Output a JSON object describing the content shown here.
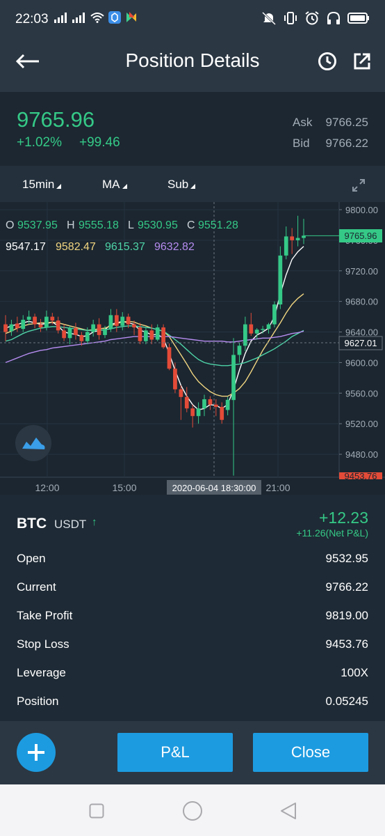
{
  "status_bar": {
    "time": "22:03",
    "icons_left": [
      "signal-icon",
      "signal-icon",
      "wifi-icon",
      "app-icon",
      "app-icon"
    ],
    "icons_right": [
      "mute-icon",
      "vibrate-icon",
      "alarm-icon",
      "headphones-icon",
      "battery-icon"
    ]
  },
  "header": {
    "title": "Position Details",
    "back_icon": "arrow-left-icon",
    "history_icon": "clock-icon",
    "share_icon": "external-link-icon"
  },
  "price": {
    "last": "9765.96",
    "change_pct": "+1.02%",
    "change_abs": "+99.46",
    "ask_label": "Ask",
    "ask": "9766.25",
    "bid_label": "Bid",
    "bid": "9766.22"
  },
  "toolbar": {
    "interval": "15min",
    "indicator": "MA",
    "sub": "Sub",
    "expand_icon": "expand-icon"
  },
  "chart": {
    "ohlc": {
      "o_label": "O",
      "o": "9537.95",
      "h_label": "H",
      "h": "9555.18",
      "l_label": "L",
      "l": "9530.95",
      "c_label": "C",
      "c": "9551.28"
    },
    "ma_values": [
      "9547.17",
      "9582.47",
      "9615.37",
      "9632.82"
    ],
    "ma_colors": [
      "#ffffff",
      "#f2d681",
      "#4fd4a8",
      "#b68cf0"
    ],
    "y_ticks": [
      "9800.00",
      "9760.00",
      "9720.00",
      "9680.00",
      "9640.00",
      "9600.00",
      "9560.00",
      "9520.00",
      "9480.00"
    ],
    "x_ticks": [
      "12:00",
      "15:00",
      "21:00"
    ],
    "crosshair_time": "2020-06-04 18:30:00",
    "crosshair_price": "9627.01",
    "last_price_tag": "9765.96",
    "bottom_tag": "9453.76",
    "up_color": "#35c987",
    "down_color": "#e34b38"
  },
  "chart_data": {
    "type": "candlestick",
    "y_range": [
      9450,
      9810
    ],
    "x_ticks": [
      "12:00",
      "15:00",
      "21:00"
    ],
    "y_ticks": [
      9800,
      9760,
      9720,
      9680,
      9640,
      9600,
      9560,
      9520,
      9480
    ],
    "candles": [
      [
        9650,
        9662,
        9628,
        9640
      ],
      [
        9641,
        9656,
        9635,
        9650
      ],
      [
        9651,
        9660,
        9640,
        9645
      ],
      [
        9644,
        9662,
        9640,
        9656
      ],
      [
        9656,
        9668,
        9650,
        9660
      ],
      [
        9660,
        9664,
        9645,
        9650
      ],
      [
        9650,
        9657,
        9640,
        9646
      ],
      [
        9646,
        9668,
        9642,
        9660
      ],
      [
        9660,
        9665,
        9650,
        9655
      ],
      [
        9655,
        9660,
        9638,
        9642
      ],
      [
        9642,
        9650,
        9628,
        9632
      ],
      [
        9632,
        9648,
        9624,
        9645
      ],
      [
        9645,
        9652,
        9630,
        9636
      ],
      [
        9636,
        9640,
        9622,
        9628
      ],
      [
        9628,
        9646,
        9624,
        9640
      ],
      [
        9640,
        9656,
        9634,
        9650
      ],
      [
        9650,
        9658,
        9630,
        9636
      ],
      [
        9636,
        9648,
        9632,
        9644
      ],
      [
        9644,
        9670,
        9640,
        9662
      ],
      [
        9662,
        9670,
        9640,
        9648
      ],
      [
        9648,
        9666,
        9642,
        9660
      ],
      [
        9660,
        9664,
        9645,
        9650
      ],
      [
        9650,
        9655,
        9636,
        9646
      ],
      [
        9646,
        9652,
        9624,
        9628
      ],
      [
        9628,
        9646,
        9624,
        9642
      ],
      [
        9642,
        9650,
        9624,
        9630
      ],
      [
        9630,
        9650,
        9628,
        9646
      ],
      [
        9646,
        9650,
        9618,
        9620
      ],
      [
        9620,
        9625,
        9590,
        9592
      ],
      [
        9592,
        9600,
        9560,
        9565
      ],
      [
        9565,
        9570,
        9525,
        9555
      ],
      [
        9555,
        9568,
        9535,
        9540
      ],
      [
        9540,
        9545,
        9515,
        9530
      ],
      [
        9530,
        9548,
        9520,
        9540
      ],
      [
        9540,
        9558,
        9530,
        9552
      ],
      [
        9552,
        9556,
        9538,
        9545
      ],
      [
        9545,
        9552,
        9530,
        9542
      ],
      [
        9542,
        9548,
        9520,
        9525
      ],
      [
        9537.95,
        9555.18,
        9530.95,
        9551.28
      ],
      [
        9551,
        9632,
        9452,
        9610
      ],
      [
        9610,
        9626,
        9600,
        9622
      ],
      [
        9622,
        9660,
        9615,
        9650
      ],
      [
        9650,
        9665,
        9635,
        9638
      ],
      [
        9638,
        9645,
        9630,
        9643
      ],
      [
        9643,
        9648,
        9638,
        9644
      ],
      [
        9644,
        9652,
        9638,
        9650
      ],
      [
        9650,
        9680,
        9646,
        9676
      ],
      [
        9676,
        9752,
        9670,
        9740
      ],
      [
        9740,
        9778,
        9735,
        9765
      ],
      [
        9765,
        9776,
        9742,
        9760
      ],
      [
        9760,
        9792,
        9752,
        9763
      ],
      [
        9763,
        9788,
        9755,
        9766
      ]
    ],
    "series": [
      {
        "name": "9547.17",
        "values": [
          9645,
          9648,
          9650,
          9652,
          9654,
          9652,
          9650,
          9651,
          9653,
          9648,
          9640,
          9638,
          9637,
          9634,
          9635,
          9640,
          9642,
          9643,
          9650,
          9652,
          9654,
          9652,
          9650,
          9642,
          9640,
          9636,
          9637,
          9632,
          9612,
          9590,
          9570,
          9556,
          9545,
          9538,
          9540,
          9545,
          9544,
          9540,
          9545,
          9565,
          9590,
          9612,
          9628,
          9636,
          9640,
          9645,
          9660,
          9690,
          9715,
          9735,
          9745,
          9752
        ]
      },
      {
        "name": "9582.47",
        "values": [
          9638,
          9641,
          9645,
          9648,
          9650,
          9651,
          9652,
          9652,
          9653,
          9652,
          9650,
          9648,
          9646,
          9644,
          9642,
          9643,
          9644,
          9645,
          9648,
          9651,
          9653,
          9654,
          9653,
          9650,
          9648,
          9645,
          9643,
          9641,
          9634,
          9622,
          9610,
          9598,
          9585,
          9575,
          9568,
          9562,
          9558,
          9556,
          9556,
          9560,
          9566,
          9575,
          9588,
          9602,
          9616,
          9628,
          9640,
          9652,
          9665,
          9676,
          9684,
          9690
        ]
      },
      {
        "name": "9615.37",
        "values": [
          9628,
          9630,
          9634,
          9638,
          9641,
          9643,
          9645,
          9646,
          9647,
          9647,
          9646,
          9645,
          9644,
          9643,
          9642,
          9642,
          9642,
          9643,
          9644,
          9646,
          9647,
          9648,
          9648,
          9647,
          9646,
          9645,
          9643,
          9641,
          9636,
          9630,
          9624,
          9617,
          9610,
          9604,
          9600,
          9598,
          9597,
          9596,
          9596,
          9597,
          9598,
          9600,
          9603,
          9606,
          9610,
          9614,
          9618,
          9623,
          9628,
          9634,
          9638,
          9642
        ]
      },
      {
        "name": "9632.82",
        "values": [
          9600,
          9603,
          9606,
          9609,
          9612,
          9614,
          9616,
          9617,
          9619,
          9620,
          9621,
          9622,
          9623,
          9624,
          9625,
          9626,
          9627,
          9628,
          9630,
          9631,
          9632,
          9633,
          9634,
          9634,
          9634,
          9634,
          9634,
          9634,
          9634,
          9633,
          9632,
          9631,
          9630,
          9629,
          9628,
          9628,
          9628,
          9628,
          9627,
          9627,
          9628,
          9629,
          9630,
          9631,
          9632,
          9632,
          9633,
          9634,
          9636,
          9638,
          9639,
          9641
        ]
      }
    ]
  },
  "position": {
    "symbol": "BTC",
    "quote": "USDT",
    "direction_icon": "arrow-up-icon",
    "arrow": "↑",
    "pnl": "+12.23",
    "net_pnl": "+11.26(Net P&L)",
    "rows": [
      {
        "label": "Open",
        "value": "9532.95"
      },
      {
        "label": "Current",
        "value": "9766.22"
      },
      {
        "label": "Take Profit",
        "value": "9819.00"
      },
      {
        "label": "Stop Loss",
        "value": "9453.76"
      },
      {
        "label": "Leverage",
        "value": "100X"
      },
      {
        "label": "Position",
        "value": "0.05245"
      }
    ]
  },
  "actions": {
    "add_icon": "plus-icon",
    "pnl_label": "P&L",
    "close_label": "Close",
    "button_color": "#1d9be0"
  },
  "system_nav": {
    "icons": [
      "recent-apps-icon",
      "home-icon",
      "back-icon"
    ]
  }
}
